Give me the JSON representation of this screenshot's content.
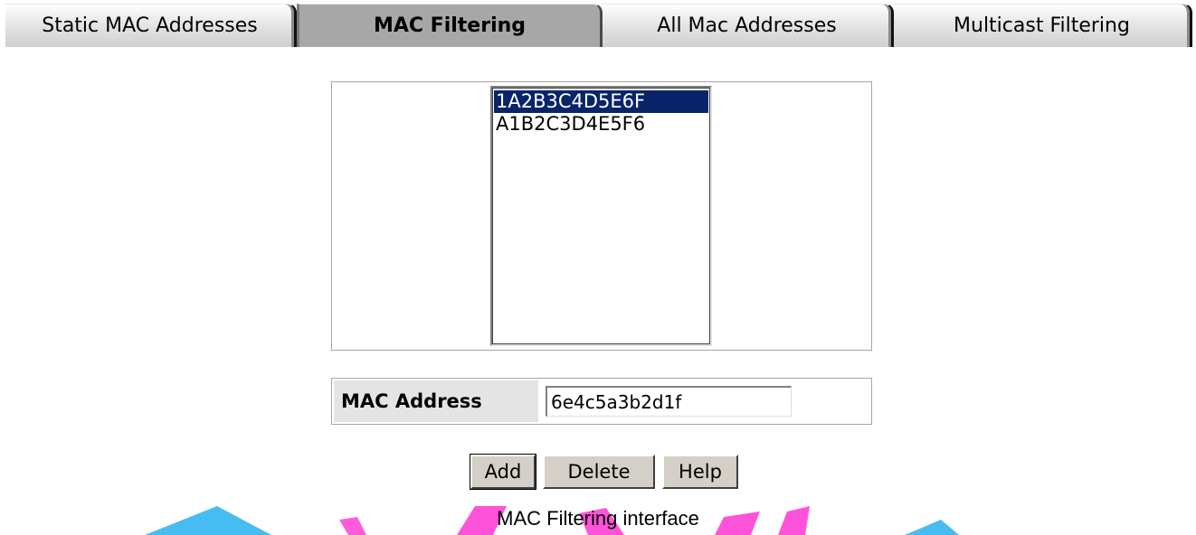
{
  "tabs": [
    {
      "label": "Static MAC Addresses",
      "active": false
    },
    {
      "label": "MAC Filtering",
      "active": true
    },
    {
      "label": "All Mac Addresses",
      "active": false
    },
    {
      "label": "Multicast Filtering",
      "active": false
    }
  ],
  "mac_list": {
    "items": [
      "1A2B3C4D5E6F",
      "A1B2C3D4E5F6"
    ],
    "selected": "1A2B3C4D5E6F"
  },
  "form": {
    "mac_address_label": "MAC Address",
    "mac_address_value": "6e4c5a3b2d1f"
  },
  "buttons": {
    "add": "Add",
    "delete": "Delete",
    "help": "Help"
  },
  "caption": "MAC Filtering interface",
  "colors": {
    "selection": "#0a246a",
    "active_tab": "#a7a7a7",
    "watermark_blue": "#33b5f0",
    "watermark_pink": "#ff3fd6"
  }
}
